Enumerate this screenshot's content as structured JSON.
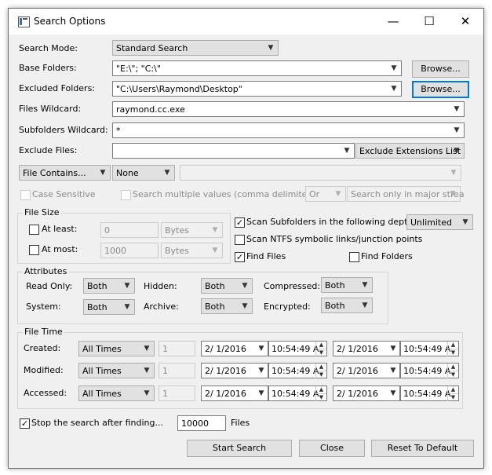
{
  "window": {
    "title": "Search Options"
  },
  "titlebar": {
    "minimize": "—",
    "maximize": "☐",
    "close": "✕"
  },
  "search_mode": {
    "label": "Search Mode:",
    "value": "Standard Search"
  },
  "base_folders": {
    "label": "Base Folders:",
    "value": "\"E:\\\"; \"C:\\\"",
    "browse": "Browse..."
  },
  "excluded_folders": {
    "label": "Excluded Folders:",
    "value": "\"C:\\Users\\Raymond\\Desktop\"",
    "browse": "Browse..."
  },
  "files_wildcard": {
    "label": "Files Wildcard:",
    "value": "raymond.cc.exe"
  },
  "subfolders_wildcard": {
    "label": "Subfolders Wildcard:",
    "value": "*"
  },
  "exclude_files": {
    "label": "Exclude Files:",
    "value": "",
    "extensions_list": "Exclude Extensions List"
  },
  "contains": {
    "mode": "File Contains...",
    "type": "None",
    "value": ""
  },
  "case_sensitive": {
    "label": "Case Sensitive",
    "checked": false
  },
  "multiple_values": {
    "label": "Search multiple values (comma delimited)",
    "checked": false,
    "operator": "Or",
    "scope": "Search only in major strea"
  },
  "file_size": {
    "title": "File Size",
    "at_least": {
      "label": "At least:",
      "value": "0",
      "unit": "Bytes",
      "checked": false
    },
    "at_most": {
      "label": "At most:",
      "value": "1000",
      "unit": "Bytes",
      "checked": false
    }
  },
  "scan_subfolders": {
    "label": "Scan Subfolders in the following depth:",
    "checked": true,
    "depth": "Unlimited"
  },
  "scan_ntfs": {
    "label": "Scan NTFS symbolic links/junction points",
    "checked": false
  },
  "find_files": {
    "label": "Find Files",
    "checked": true
  },
  "find_folders": {
    "label": "Find Folders",
    "checked": false
  },
  "attributes": {
    "title": "Attributes",
    "read_only": {
      "label": "Read Only:",
      "value": "Both"
    },
    "hidden": {
      "label": "Hidden:",
      "value": "Both"
    },
    "compressed": {
      "label": "Compressed:",
      "value": "Both"
    },
    "system": {
      "label": "System:",
      "value": "Both"
    },
    "archive": {
      "label": "Archive:",
      "value": "Both"
    },
    "encrypted": {
      "label": "Encrypted:",
      "value": "Both"
    }
  },
  "file_time": {
    "title": "File Time",
    "rows": [
      {
        "label": "Created:",
        "mode": "All Times",
        "count": "1",
        "date1": "2/  1/2016",
        "time1": "10:54:49 A",
        "date2": "2/  1/2016",
        "time2": "10:54:49 A"
      },
      {
        "label": "Modified:",
        "mode": "All Times",
        "count": "1",
        "date1": "2/  1/2016",
        "time1": "10:54:49 A",
        "date2": "2/  1/2016",
        "time2": "10:54:49 A"
      },
      {
        "label": "Accessed:",
        "mode": "All Times",
        "count": "1",
        "date1": "2/  1/2016",
        "time1": "10:54:49 A",
        "date2": "2/  1/2016",
        "time2": "10:54:49 A"
      }
    ]
  },
  "stop_search": {
    "label": "Stop the search after finding...",
    "checked": true,
    "value": "10000",
    "unit": "Files"
  },
  "buttons": {
    "start": "Start Search",
    "close": "Close",
    "reset": "Reset To Default"
  }
}
